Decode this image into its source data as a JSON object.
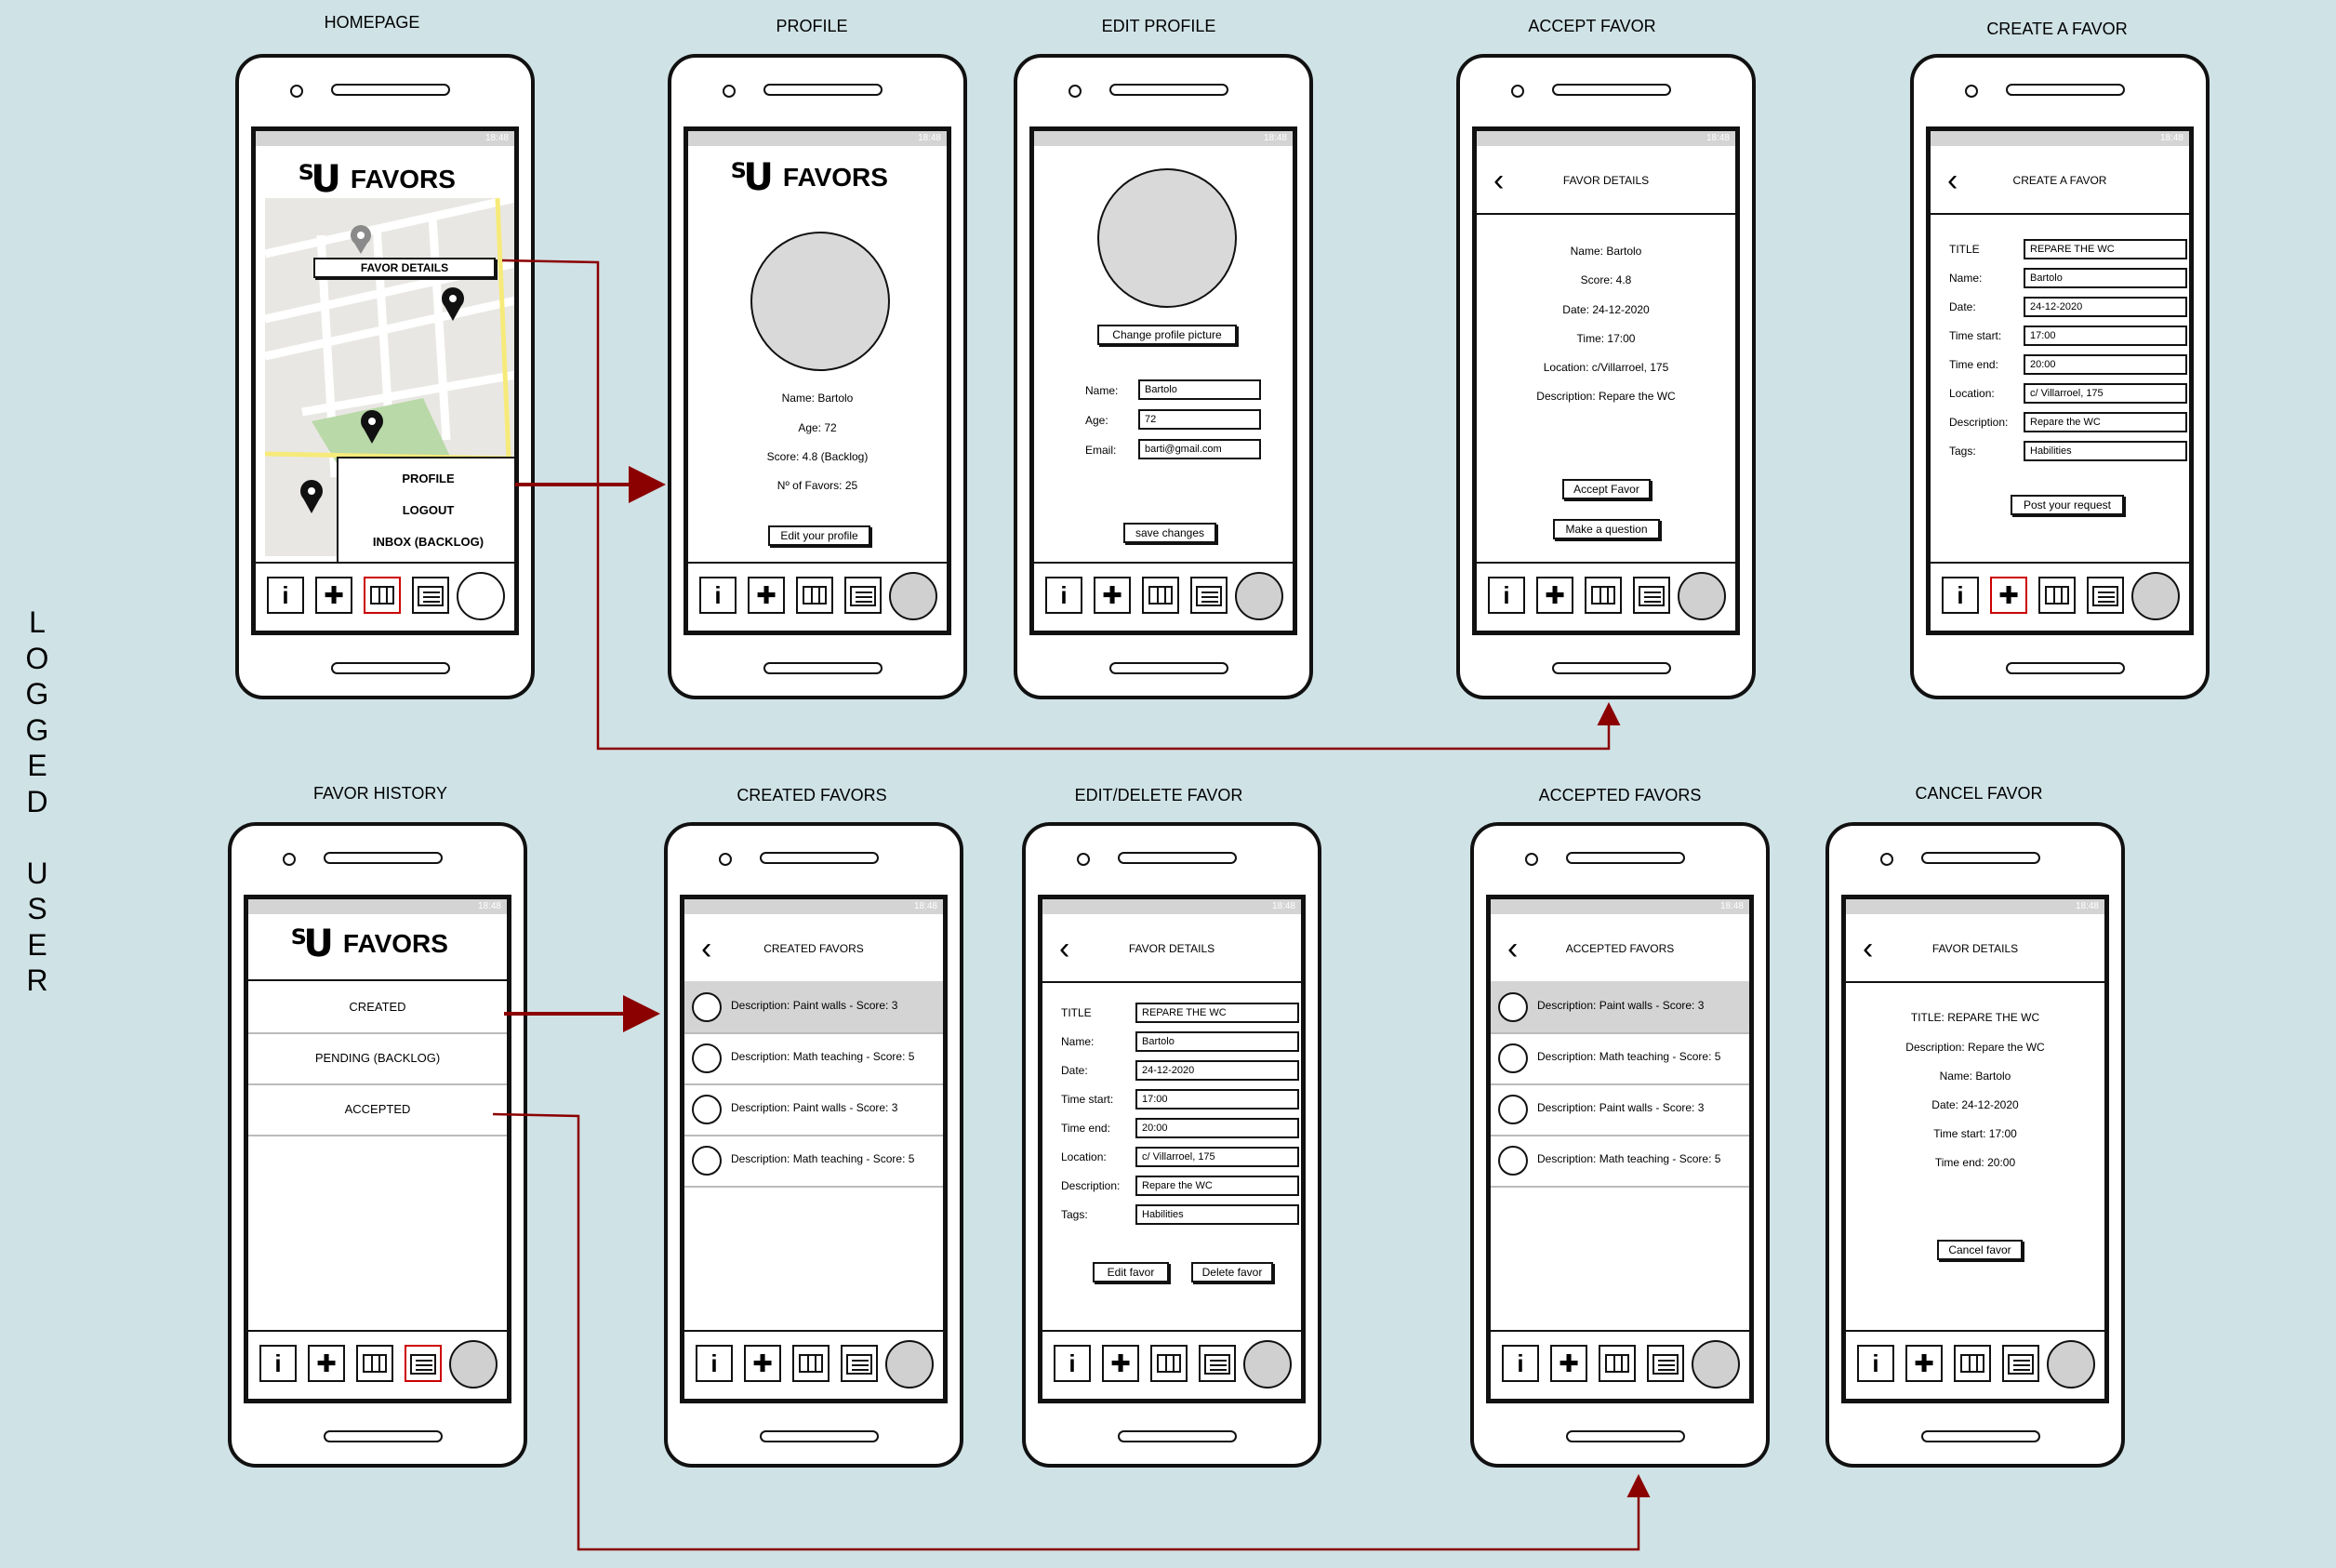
{
  "side_label": "LOGGED USER",
  "colors": {
    "background": "#cfe2e6",
    "arrow": "#8b0000",
    "active_tab": "#cc0000"
  },
  "status_time": "18:48",
  "navbar_icons": [
    "info-icon",
    "plus-icon",
    "map-icon",
    "list-icon",
    "avatar"
  ],
  "screens": {
    "homepage": {
      "title": "HOMEPAGE",
      "logo": "FAVORS",
      "map_popup": "FAVOR DETAILS",
      "menu": [
        "PROFILE",
        "LOGOUT",
        "INBOX (BACKLOG)"
      ]
    },
    "profile": {
      "title": "PROFILE",
      "logo": "FAVORS",
      "lines": [
        "Name: Bartolo",
        "Age: 72",
        "Score: 4.8 (Backlog)",
        "Nº of Favors: 25"
      ],
      "button": "Edit your profile"
    },
    "edit_profile": {
      "title": "EDIT PROFILE",
      "change_picture": "Change profile picture",
      "fields": [
        {
          "label": "Name:",
          "value": "Bartolo"
        },
        {
          "label": "Age:",
          "value": "72"
        },
        {
          "label": "Email:",
          "value": "barti@gmail.com"
        }
      ],
      "save": "save changes"
    },
    "accept_favor": {
      "title": "ACCEPT FAVOR",
      "header": "FAVOR DETAILS",
      "lines": [
        "Name: Bartolo",
        "Score: 4.8",
        "Date: 24-12-2020",
        "Time: 17:00",
        "Location: c/Villarroel, 175",
        "Description: Repare the WC"
      ],
      "accept": "Accept Favor",
      "question": "Make a question"
    },
    "create_favor": {
      "title": "CREATE A FAVOR",
      "header": "CREATE A FAVOR",
      "fields": [
        {
          "label": "TITLE",
          "value": "REPARE THE WC"
        },
        {
          "label": "Name:",
          "value": "Bartolo"
        },
        {
          "label": "Date:",
          "value": "24-12-2020"
        },
        {
          "label": "Time start:",
          "value": "17:00"
        },
        {
          "label": "Time end:",
          "value": "20:00"
        },
        {
          "label": "Location:",
          "value": "c/ Villarroel, 175"
        },
        {
          "label": "Description:",
          "value": "Repare the WC"
        },
        {
          "label": "Tags:",
          "value": "Habilities"
        }
      ],
      "post": "Post your request"
    },
    "favor_history": {
      "title": "FAVOR HISTORY",
      "logo": "FAVORS",
      "items": [
        "CREATED",
        "PENDING (BACKLOG)",
        "ACCEPTED"
      ]
    },
    "created_favors": {
      "title": "CREATED FAVORS",
      "header": "CREATED FAVORS",
      "items": [
        "Description: Paint walls - Score: 3",
        "Description: Math teaching - Score: 5",
        "Description: Paint walls - Score: 3",
        "Description: Math teaching - Score: 5"
      ]
    },
    "edit_delete_favor": {
      "title": "EDIT/DELETE FAVOR",
      "header": "FAVOR DETAILS",
      "fields": [
        {
          "label": "TITLE",
          "value": "REPARE THE WC"
        },
        {
          "label": "Name:",
          "value": "Bartolo"
        },
        {
          "label": "Date:",
          "value": "24-12-2020"
        },
        {
          "label": "Time start:",
          "value": "17:00"
        },
        {
          "label": "Time end:",
          "value": "20:00"
        },
        {
          "label": "Location:",
          "value": "c/ Villarroel, 175"
        },
        {
          "label": "Description:",
          "value": "Repare the WC"
        },
        {
          "label": "Tags:",
          "value": "Habilities"
        }
      ],
      "edit": "Edit favor",
      "delete": "Delete favor"
    },
    "accepted_favors": {
      "title": "ACCEPTED FAVORS",
      "header": "ACCEPTED FAVORS",
      "items": [
        "Description: Paint walls - Score: 3",
        "Description: Math teaching - Score: 5",
        "Description: Paint walls - Score: 3",
        "Description: Math teaching - Score: 5"
      ]
    },
    "cancel_favor": {
      "title": "CANCEL FAVOR",
      "header": "FAVOR DETAILS",
      "lines": [
        "TITLE: REPARE THE WC",
        "Description: Repare the WC",
        "Name: Bartolo",
        "Date: 24-12-2020",
        "Time start: 17:00",
        "Time end: 20:00"
      ],
      "cancel": "Cancel favor"
    }
  }
}
